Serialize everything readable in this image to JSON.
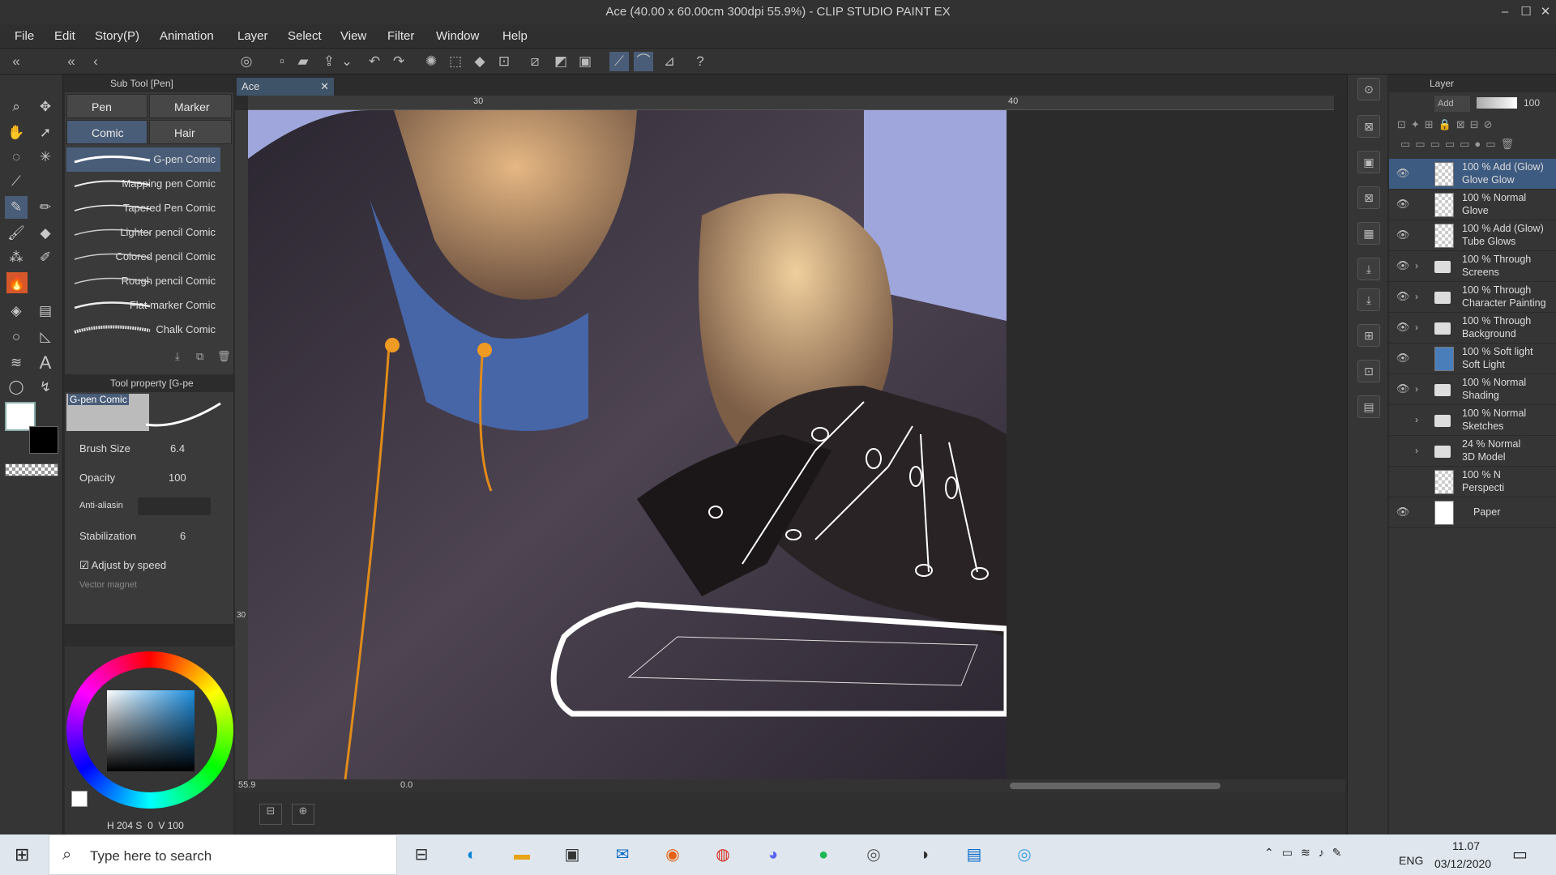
{
  "window": {
    "title": "Ace (40.00 x 60.00cm 300dpi 55.9%)  - CLIP STUDIO PAINT EX"
  },
  "menu": [
    "File",
    "Edit",
    "Story(P)",
    "Animation",
    "Layer",
    "Select",
    "View",
    "Filter",
    "Window",
    "Help"
  ],
  "subtool": {
    "header": "Sub Tool [Pen]",
    "tab_pen": "Pen",
    "tab_marker": "Marker",
    "tab_comic": "Comic Brus",
    "tab_hair": "Hair Brushe",
    "brushes": [
      "G-pen Comic",
      "Mapping pen Comic",
      "Tapered Pen Comic",
      "Lighter pencil Comic",
      "Colored pencil Comic",
      "Rough pencil Comic",
      "Flat marker Comic",
      "Chalk Comic"
    ]
  },
  "toolprop": {
    "header": "Tool property [G-pe",
    "preview_name": "G-pen Comic",
    "brush_size_label": "Brush Size",
    "brush_size": "6.4",
    "opacity_label": "Opacity",
    "opacity": "100",
    "aa_label": "Anti-aliasin",
    "stab_label": "Stabilization",
    "stab": "6",
    "adjust_label": "Adjust by speed",
    "vector_label": "Vector magnet"
  },
  "color": {
    "h": "H 204",
    "s": "S",
    "s_val": "0",
    "v": "V 100",
    "hue_hex": "#1e4f7a"
  },
  "canvas": {
    "tab": "Ace",
    "ruler_30": "30",
    "ruler_40": "40",
    "vruler_30": "30",
    "zoom": "55.9",
    "angle": "0.0"
  },
  "layerpanel": {
    "title": "Layer",
    "blend": "Add",
    "opacity": "100",
    "layers": [
      {
        "l1": "100 % Add (Glow)",
        "l2": "Glove Glow",
        "kind": "raster",
        "visible": true,
        "selected": true
      },
      {
        "l1": "100 % Normal",
        "l2": "Glove",
        "kind": "raster",
        "visible": true,
        "selected": false
      },
      {
        "l1": "100 % Add (Glow)",
        "l2": "Tube Glows",
        "kind": "raster",
        "visible": true,
        "selected": false
      },
      {
        "l1": "100 % Through",
        "l2": "Screens",
        "kind": "folder",
        "visible": true,
        "selected": false
      },
      {
        "l1": "100 % Through",
        "l2": "Character Painting",
        "kind": "folder",
        "visible": true,
        "selected": false
      },
      {
        "l1": "100 % Through",
        "l2": "Background",
        "kind": "folder",
        "visible": true,
        "selected": false
      },
      {
        "l1": "100 % Soft light",
        "l2": "Soft Light",
        "kind": "blue",
        "visible": true,
        "selected": false
      },
      {
        "l1": "100 % Normal",
        "l2": "Shading",
        "kind": "folder",
        "visible": true,
        "selected": false
      },
      {
        "l1": "100 % Normal",
        "l2": "Sketches",
        "kind": "folder",
        "visible": false,
        "selected": false
      },
      {
        "l1": "24 % Normal",
        "l2": "3D Model",
        "kind": "folder",
        "visible": false,
        "selected": false
      },
      {
        "l1": "100 % N",
        "l2": "Perspecti",
        "kind": "ruler",
        "visible": false,
        "selected": false
      },
      {
        "l1": "",
        "l2": "Paper",
        "kind": "paper",
        "visible": true,
        "selected": false
      }
    ]
  },
  "taskbar": {
    "search_placeholder": "Type here to search",
    "lang": "ENG",
    "time": "11.07",
    "date": "03/12/2020"
  }
}
